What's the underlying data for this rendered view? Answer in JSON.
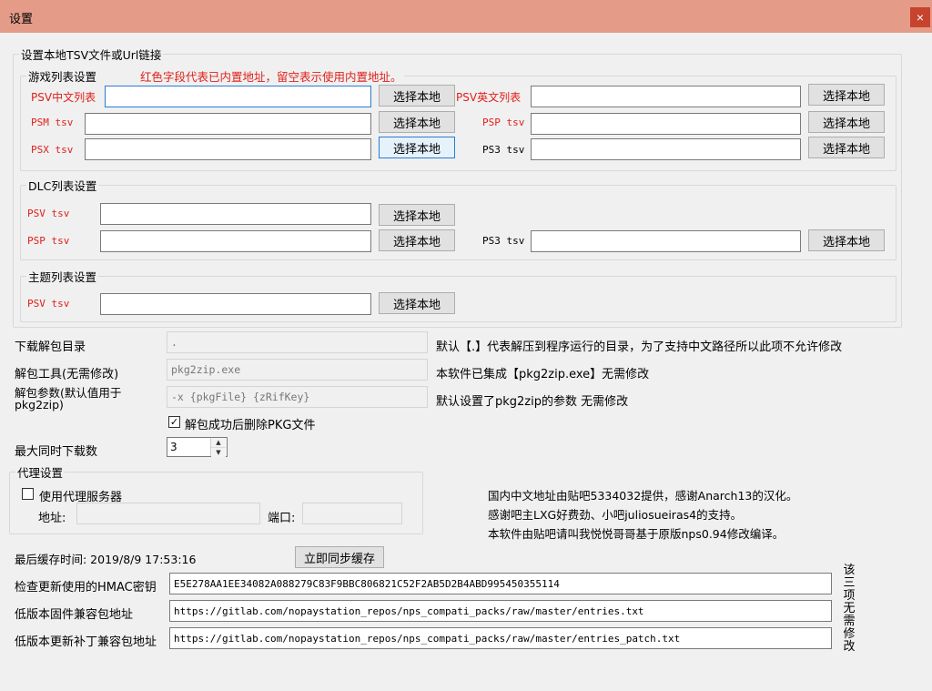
{
  "window": {
    "title": "设置",
    "close_icon": "×"
  },
  "tsv_group": {
    "legend": "设置本地TSV文件或Url链接",
    "game_group": {
      "legend": "游戏列表设置",
      "hint": "红色字段代表已内置地址，留空表示使用内置地址。",
      "psv_cn_label": "PSV中文列表",
      "psv_en_label": "PSV英文列表",
      "psm_label": "PSM tsv",
      "psp_label": "PSP tsv",
      "psx_label": "PSX tsv",
      "ps3_label": "PS3 tsv"
    },
    "dlc_group": {
      "legend": "DLC列表设置",
      "psv_label": "PSV tsv",
      "psp_label": "PSP tsv",
      "ps3_label": "PS3 tsv"
    },
    "theme_group": {
      "legend": "主题列表设置",
      "psv_label": "PSV tsv"
    },
    "browse_label": "选择本地"
  },
  "extract": {
    "dir_label": "下载解包目录",
    "dir_value": ".",
    "dir_note": "默认【.】代表解压到程序运行的目录，为了支持中文路径所以此项不允许修改",
    "tool_label": "解包工具(无需修改)",
    "tool_value": "pkg2zip.exe",
    "tool_note": "本软件已集成【pkg2zip.exe】无需修改",
    "args_label": "解包参数(默认值用于pkg2zip)",
    "args_value": "-x {pkgFile} {zRifKey}",
    "args_note": "默认设置了pkg2zip的参数 无需修改",
    "delete_pkg_label": "解包成功后删除PKG文件",
    "delete_pkg_checked": true
  },
  "max_downloads": {
    "label": "最大同时下载数",
    "value": "3"
  },
  "proxy": {
    "legend": "代理设置",
    "use_proxy_label": "使用代理服务器",
    "use_proxy_checked": false,
    "address_label": "地址:",
    "port_label": "端口:"
  },
  "credits": {
    "line1": "国内中文地址由贴吧5334032提供，感谢Anarch13的汉化。",
    "line2": "感谢吧主LXG好费劲、小吧juliosueiras4的支持。",
    "line3": "本软件由贴吧请叫我悦悦哥哥基于原版nps0.94修改编译。"
  },
  "cache": {
    "label": "最后缓存时间: 2019/8/9 17:53:16",
    "sync_button": "立即同步缓存"
  },
  "hmac": {
    "label": "检查更新使用的HMAC密钥",
    "value": "E5E278AA1EE34082A088279C83F9BBC806821C52F2AB5D2B4ABD995450355114"
  },
  "compat": {
    "label": "低版本固件兼容包地址",
    "value": "https://gitlab.com/nopaystation_repos/nps_compati_packs/raw/master/entries.txt"
  },
  "patch": {
    "label": "低版本更新补丁兼容包地址",
    "value": "https://gitlab.com/nopaystation_repos/nps_compati_packs/raw/master/entries_patch.txt"
  },
  "side_note": "该三项无需修改",
  "colors": {
    "title_bar": "#e49c88",
    "close_button": "#c6432e",
    "required_label": "#e0201a",
    "focus_border": "#2a7bd8"
  }
}
